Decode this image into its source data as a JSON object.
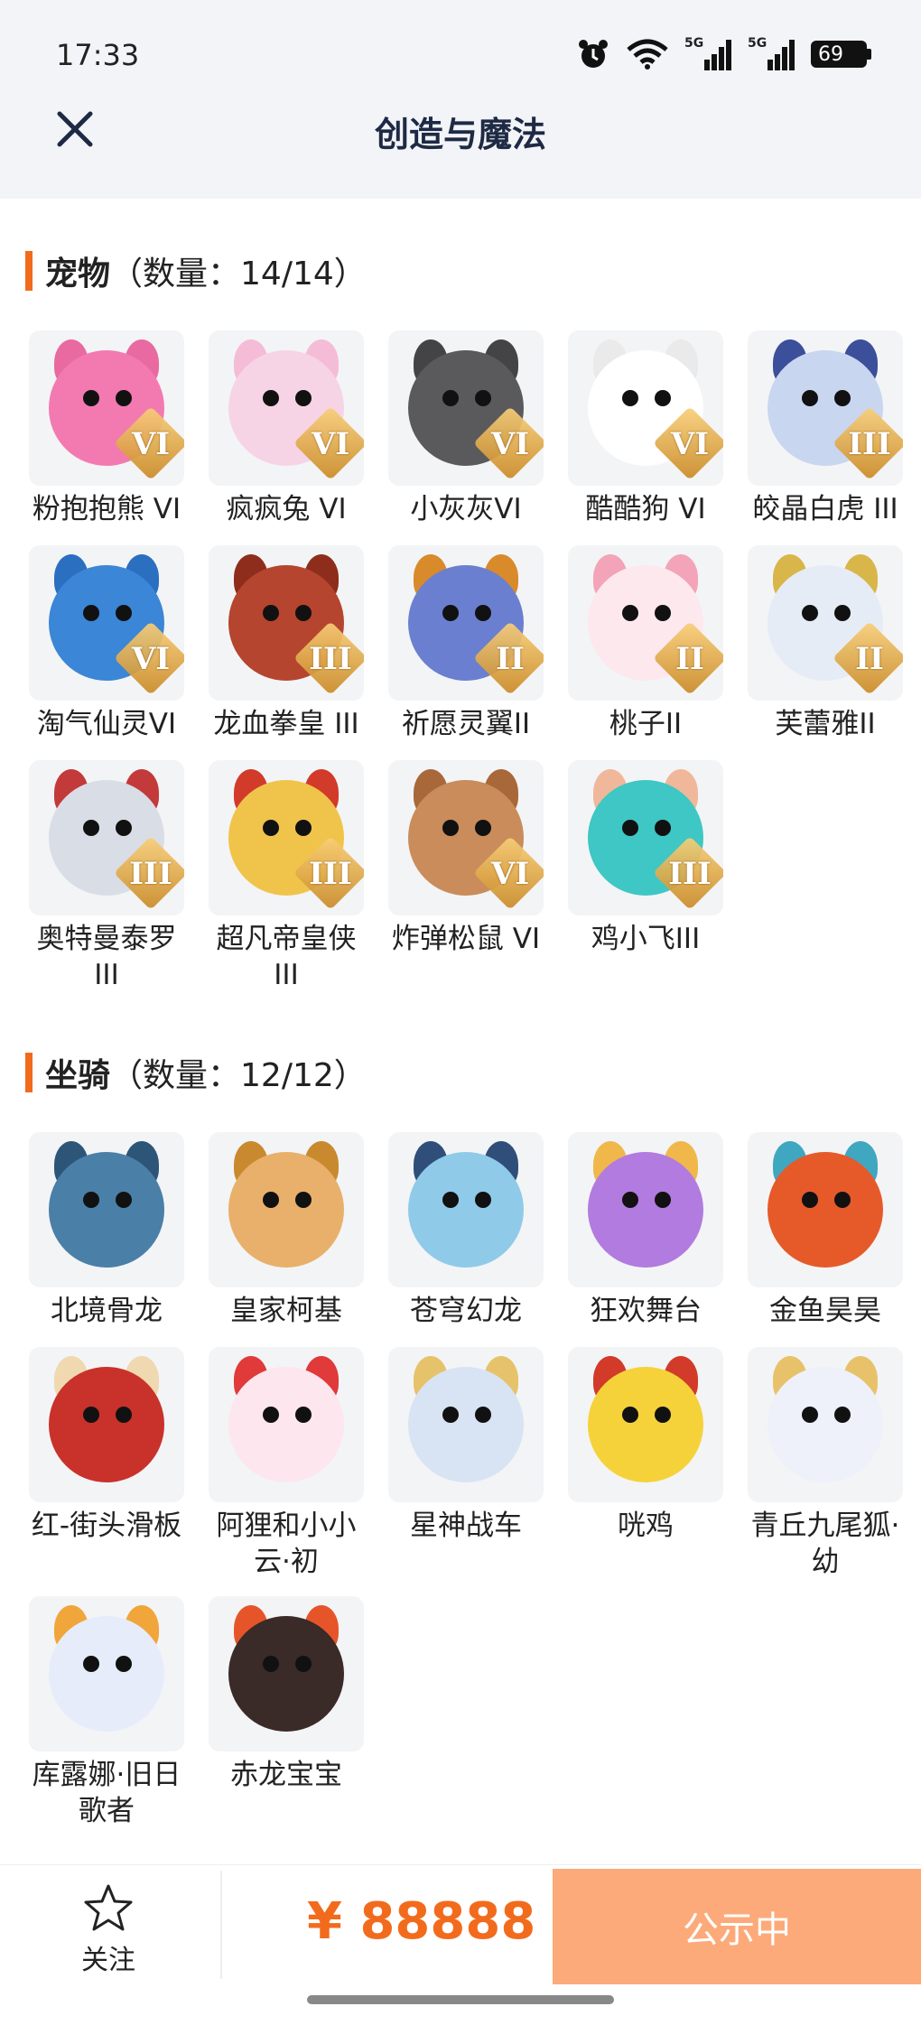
{
  "status": {
    "time": "17:33",
    "battery": "69",
    "sig1": "5G",
    "sig2": "5G"
  },
  "header": {
    "title": "创造与魔法"
  },
  "pets": {
    "name": "宠物",
    "count": "（数量：14/14）",
    "items": [
      {
        "label": "粉抱抱熊 VI",
        "badge": "VI",
        "color": "#f37ab0",
        "ear": "#e86aa0"
      },
      {
        "label": "疯疯兔 VI",
        "badge": "VI",
        "color": "#f6d4e6",
        "ear": "#f5bcd8"
      },
      {
        "label": "小灰灰VI",
        "badge": "VI",
        "color": "#5a5a5c",
        "ear": "#444446"
      },
      {
        "label": "酷酷狗 VI",
        "badge": "VI",
        "color": "#ffffff",
        "ear": "#eaeaea"
      },
      {
        "label": "皎晶白虎 III",
        "badge": "III",
        "color": "#c9d6f0",
        "ear": "#3c4f9a"
      },
      {
        "label": "淘气仙灵VI",
        "badge": "VI",
        "color": "#3b86d6",
        "ear": "#2a6fc0"
      },
      {
        "label": "龙血拳皇 III",
        "badge": "III",
        "color": "#b5452e",
        "ear": "#8e2d1c"
      },
      {
        "label": "祈愿灵翼II",
        "badge": "II",
        "color": "#6b7fd0",
        "ear": "#d98a2a"
      },
      {
        "label": "桃子II",
        "badge": "II",
        "color": "#fde8ee",
        "ear": "#f3a4b8"
      },
      {
        "label": "芙蕾雅II",
        "badge": "II",
        "color": "#e6ecf6",
        "ear": "#d8b64a"
      },
      {
        "label": "奥特曼泰罗III",
        "badge": "III",
        "color": "#d9dde6",
        "ear": "#c23a3a"
      },
      {
        "label": "超凡帝皇侠III",
        "badge": "III",
        "color": "#f0c44a",
        "ear": "#d23a2a"
      },
      {
        "label": "炸弹松鼠 VI",
        "badge": "VI",
        "color": "#c98c5a",
        "ear": "#a8683a"
      },
      {
        "label": "鸡小飞III",
        "badge": "III",
        "color": "#3ec7c4",
        "ear": "#f0b79a"
      }
    ]
  },
  "mounts": {
    "name": "坐骑",
    "count": "（数量：12/12）",
    "items": [
      {
        "label": "北境骨龙",
        "color": "#4a7fa8",
        "ear": "#2d5578"
      },
      {
        "label": "皇家柯基",
        "color": "#e8b06a",
        "ear": "#c9892e"
      },
      {
        "label": "苍穹幻龙",
        "color": "#8fcbe8",
        "ear": "#2f4f7a"
      },
      {
        "label": "狂欢舞台",
        "color": "#b27be0",
        "ear": "#f0b84a"
      },
      {
        "label": "金鱼昊昊",
        "color": "#e65a2a",
        "ear": "#3fa7c0"
      },
      {
        "label": "红-街头滑板",
        "color": "#c8322a",
        "ear": "#f0d8b0"
      },
      {
        "label": "阿狸和小小云·初",
        "color": "#fde6ee",
        "ear": "#e03a3a"
      },
      {
        "label": "星神战车",
        "color": "#d8e4f4",
        "ear": "#e6c26a"
      },
      {
        "label": "咣鸡",
        "color": "#f6d23a",
        "ear": "#d23a2a"
      },
      {
        "label": "青丘九尾狐·幼",
        "color": "#eef0fa",
        "ear": "#e8c26a"
      },
      {
        "label": "库露娜·旧日歌者",
        "color": "#e6ecfa",
        "ear": "#f0a63a"
      },
      {
        "label": "赤龙宝宝",
        "color": "#3a2a28",
        "ear": "#e6552a"
      }
    ]
  },
  "bottom": {
    "follow_label": "关注",
    "price": "¥ 88888",
    "cta_label": "公示中"
  }
}
